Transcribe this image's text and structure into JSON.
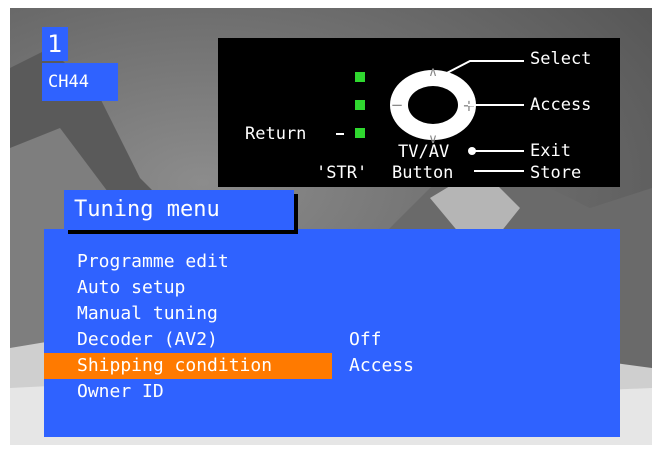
{
  "channel": {
    "number": "1",
    "name": "CH44"
  },
  "help": {
    "select": "Select",
    "access": "Access",
    "return": "Return",
    "tvav": "TV/AV",
    "exit": "Exit",
    "str": "'STR'",
    "button": "Button",
    "store": "Store"
  },
  "menu": {
    "title": "Tuning menu",
    "items": [
      {
        "label": "Programme edit"
      },
      {
        "label": "Auto setup"
      },
      {
        "label": "Manual tuning"
      },
      {
        "label": "Decoder (AV2)",
        "value": "Off"
      },
      {
        "label": "Shipping condition",
        "value": "Access",
        "selected": true
      },
      {
        "label": "Owner ID"
      }
    ]
  },
  "colors": {
    "menu_bg": "#2f62ff",
    "highlight": "#ff7a00",
    "indicator": "#2fd82f"
  }
}
